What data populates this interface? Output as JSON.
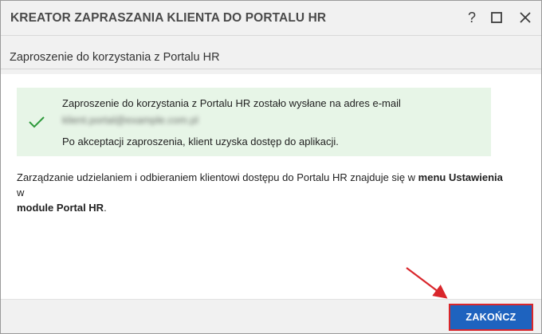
{
  "window": {
    "title": "KREATOR ZAPRASZANIA KLIENTA DO PORTALU HR",
    "help_label": "?",
    "icons": [
      "help-icon",
      "maximize-icon",
      "close-icon"
    ]
  },
  "section": {
    "title": "Zaproszenie do korzystania z Portalu HR"
  },
  "success": {
    "icon": "checkmark-icon",
    "message": "Zaproszenie do korzystania z Portalu HR zostało wysłane na adres e-mail",
    "email": "klient.portal@example.com.pl",
    "followup": "Po akceptacji zaproszenia, klient uzyska dostęp do aplikacji."
  },
  "info": {
    "text_before": "Zarządzanie udzielaniem i odbieraniem klientowi dostępu do Portalu HR znajduje się w ",
    "bold_menu": "menu Ustawienia",
    "text_middle": " w ",
    "bold_module": "module Portal HR",
    "text_after": "."
  },
  "footer": {
    "finish_label": "ZAKOŃCZ"
  },
  "colors": {
    "primary_button": "#1e63bf",
    "success_bg": "#e7f5e7",
    "success_check": "#2e9a3c",
    "annotation_red": "#d9262b"
  }
}
